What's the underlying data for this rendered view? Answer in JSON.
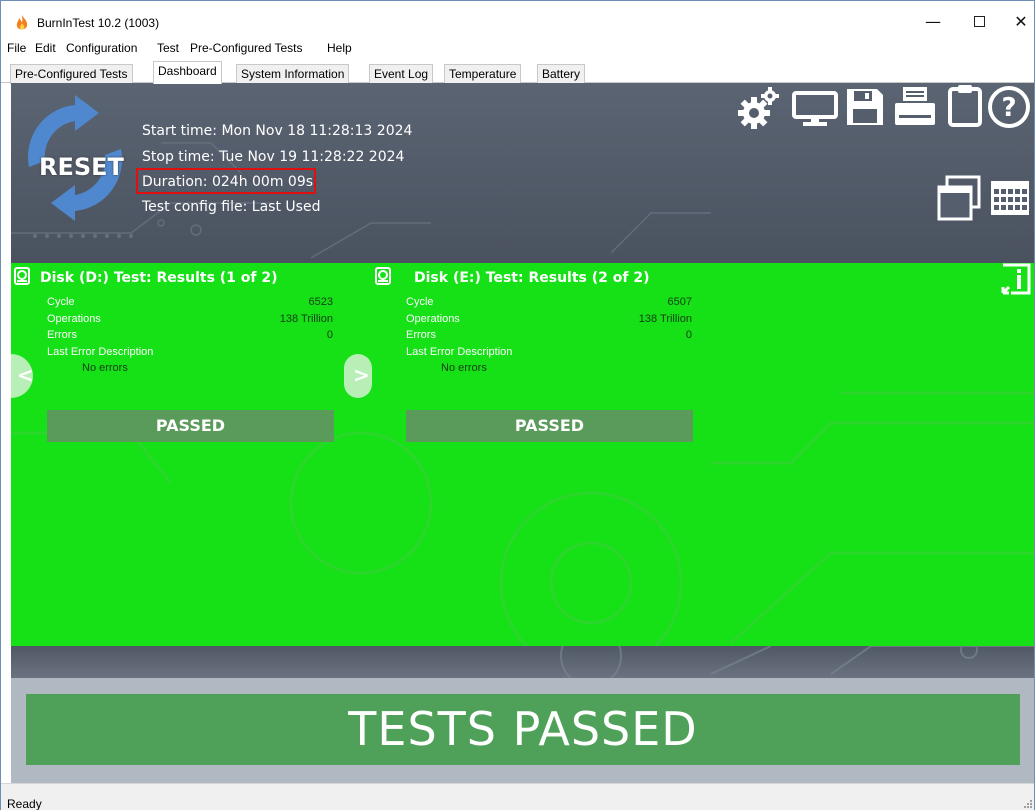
{
  "window": {
    "title": "BurnInTest 10.2 (1003)",
    "controls": {
      "minimize": "—",
      "close": "✕"
    }
  },
  "menu": [
    "File",
    "Edit",
    "Configuration",
    "Test",
    "Pre-Configured Tests",
    "Help"
  ],
  "tabs": [
    {
      "label": "Pre-Configured Tests",
      "active": false
    },
    {
      "label": "Dashboard",
      "active": true
    },
    {
      "label": "System Information",
      "active": false
    },
    {
      "label": "Event Log",
      "active": false
    },
    {
      "label": "Temperature",
      "active": false
    },
    {
      "label": "Battery",
      "active": false
    }
  ],
  "dashboard": {
    "reset_label": "RESET",
    "start_time": "Start time: Mon Nov 18 11:28:13 2024",
    "stop_time": "Stop time: Tue Nov 19 11:28:22 2024",
    "duration": "Duration: 024h 00m 09s",
    "config_file": "Test config file: Last Used",
    "highlight_color": "#e01010",
    "toolbar_icons": [
      "gears-icon",
      "monitor-icon",
      "save-icon",
      "printer-icon",
      "clipboard-icon",
      "help-icon",
      "windows-icon",
      "calendar-icon"
    ]
  },
  "results": {
    "background": "#16e016",
    "disks": [
      {
        "title": "Disk (D:) Test: Results (1 of 2)",
        "cycle_label": "Cycle",
        "cycle": "6523",
        "operations_label": "Operations",
        "operations": "138 Trillion",
        "errors_label": "Errors",
        "errors": "0",
        "last_error_label": "Last Error Description",
        "last_error": "No errors",
        "status": "PASSED"
      },
      {
        "title": "Disk (E:) Test: Results (2 of 2)",
        "cycle_label": "Cycle",
        "cycle": "6507",
        "operations_label": "Operations",
        "operations": "138 Trillion",
        "errors_label": "Errors",
        "errors": "0",
        "last_error_label": "Last Error Description",
        "last_error": "No errors",
        "status": "PASSED"
      }
    ],
    "nav": {
      "prev": "<",
      "next": ">"
    }
  },
  "summary": {
    "label": "TESTS PASSED",
    "color": "#4fa15a"
  },
  "status_bar": {
    "text": "Ready"
  }
}
